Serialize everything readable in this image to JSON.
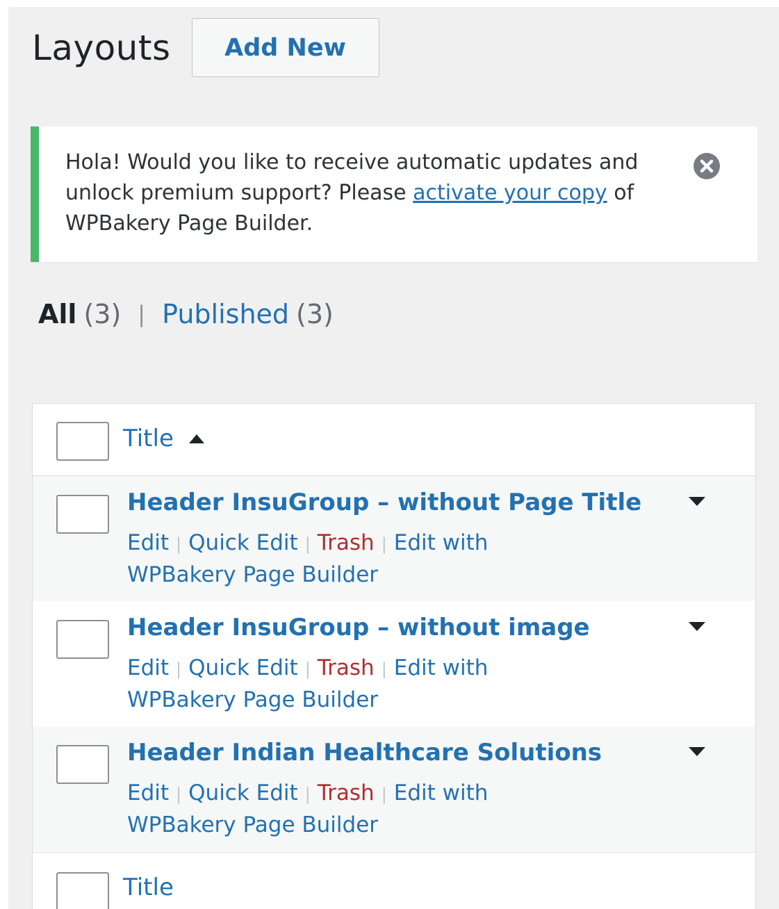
{
  "header": {
    "title": "Layouts",
    "add_new_label": "Add New"
  },
  "notice": {
    "text_before": "Hola! Would you like to receive automatic updates and unlock premium support? Please ",
    "link_label": "activate your copy",
    "text_after": " of WPBakery Page Builder.",
    "accent_color": "#4ab866",
    "dismiss_icon": "close-circle-icon"
  },
  "filters": {
    "all_label": "All",
    "all_count": "(3)",
    "separator": "|",
    "published_label": "Published",
    "published_count": "(3)"
  },
  "table": {
    "header_title": "Title",
    "footer_title": "Title",
    "sort_icon": "sort-ascending-icon",
    "rows": [
      {
        "title": "Header InsuGroup – without Page Title",
        "actions": {
          "edit": "Edit",
          "quick_edit": "Quick Edit",
          "trash": "Trash",
          "builder": "Edit with WPBakery Page Builder"
        }
      },
      {
        "title": "Header InsuGroup – without image",
        "actions": {
          "edit": "Edit",
          "quick_edit": "Quick Edit",
          "trash": "Trash",
          "builder": "Edit with WPBakery Page Builder"
        }
      },
      {
        "title": "Header Indian Healthcare Solutions",
        "actions": {
          "edit": "Edit",
          "quick_edit": "Quick Edit",
          "trash": "Trash",
          "builder": "Edit with WPBakery Page Builder"
        }
      }
    ]
  },
  "colors": {
    "link": "#2271b1",
    "trash": "#b32d2e",
    "background": "#f0f0f1"
  }
}
